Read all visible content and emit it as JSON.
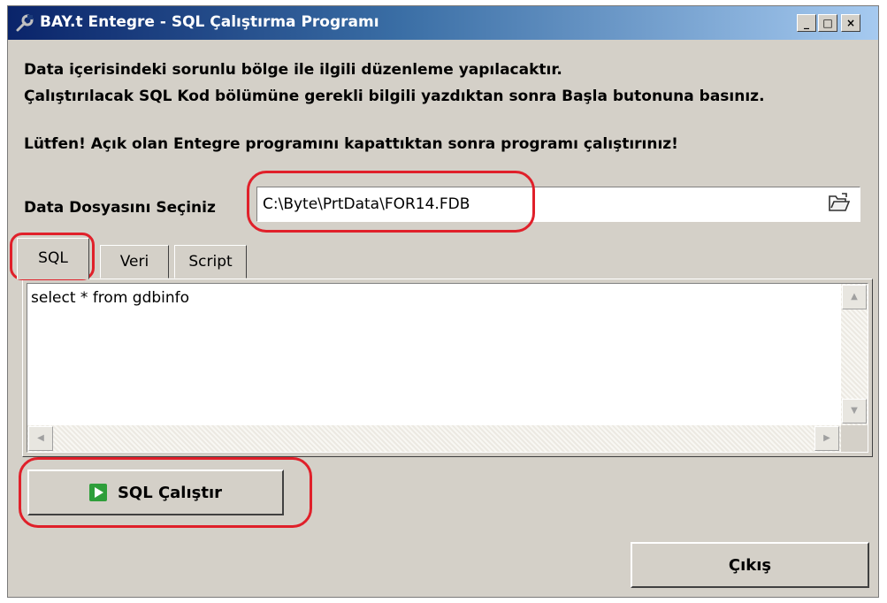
{
  "window": {
    "title": "BAY.t Entegre - SQL Çalıştırma Programı",
    "controls": [
      "_",
      "□",
      "×"
    ]
  },
  "info": {
    "line1": "Data içerisindeki sorunlu bölge ile ilgili düzenleme yapılacaktır.",
    "line2": "Çalıştırılacak SQL Kod bölümüne gerekli bilgili yazdıktan sonra Başla butonuna basınız.",
    "line3": "Lütfen! Açık olan Entegre programını kapattıktan sonra programı çalıştırınız!"
  },
  "data_file": {
    "label": "Data Dosyasını Seçiniz",
    "value": "C:\\Byte\\PrtData\\FOR14.FDB"
  },
  "tabs": [
    {
      "label": "SQL",
      "active": true
    },
    {
      "label": "Veri",
      "active": false
    },
    {
      "label": "Script",
      "active": false
    }
  ],
  "editor": {
    "value": "select * from gdbinfo"
  },
  "buttons": {
    "run_label": "SQL Çalıştır",
    "exit_label": "Çıkış"
  },
  "colors": {
    "highlight": "#e0202a",
    "window_bg": "#d4d0c8",
    "title_start": "#0a246a",
    "title_end": "#a6caf0"
  }
}
